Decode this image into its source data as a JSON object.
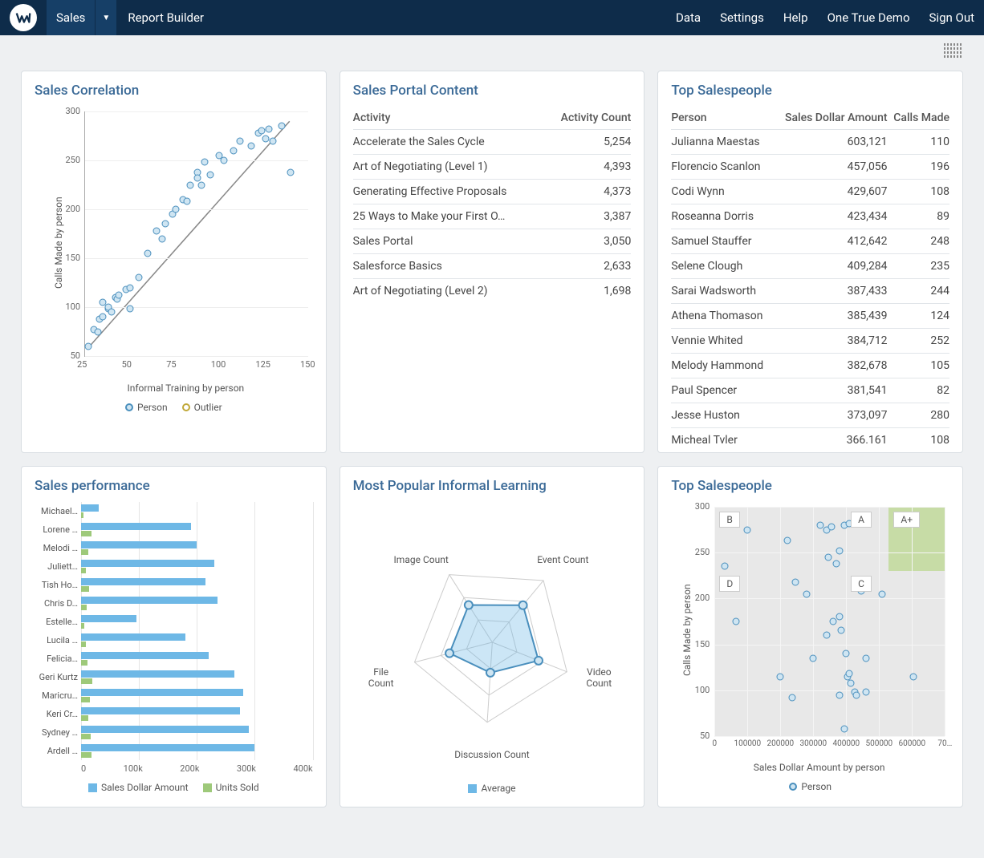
{
  "nav": {
    "sales": "Sales",
    "report_builder": "Report Builder",
    "data": "Data",
    "settings": "Settings",
    "help": "Help",
    "demo": "One True Demo",
    "signout": "Sign Out"
  },
  "cards": {
    "sales_correlation": {
      "title": "Sales Correlation",
      "ylabel": "Calls Made by person",
      "xlabel": "Informal Training by person",
      "legend_person": "Person",
      "legend_outlier": "Outlier"
    },
    "sales_portal": {
      "title": "Sales Portal Content",
      "col_activity": "Activity",
      "col_count": "Activity Count"
    },
    "top_salespeople_tbl": {
      "title": "Top Salespeople",
      "col_person": "Person",
      "col_amount": "Sales Dollar Amount",
      "col_calls": "Calls Made"
    },
    "sales_perf": {
      "title": "Sales performance",
      "legend_sales": "Sales Dollar Amount",
      "legend_units": "Units Sold"
    },
    "informal": {
      "title": "Most Popular Informal Learning",
      "legend_avg": "Average",
      "ax_image": "Image Count",
      "ax_event": "Event Count",
      "ax_video": "Video\nCount",
      "ax_disc": "Discussion Count",
      "ax_file": "File\nCount"
    },
    "top_salespeople_sc": {
      "title": "Top Salespeople",
      "ylabel": "Calls Made by person",
      "xlabel": "Sales Dollar Amount by person",
      "legend_person": "Person",
      "qA": "A",
      "qAplus": "A+",
      "qB": "B",
      "qC": "C",
      "qD": "D"
    }
  },
  "portal_rows": [
    {
      "activity": "Accelerate the Sales Cycle",
      "count": "5,254"
    },
    {
      "activity": "Art of Negotiating (Level 1)",
      "count": "4,393"
    },
    {
      "activity": "Generating Effective Proposals",
      "count": "4,373"
    },
    {
      "activity": "25 Ways to Make your First O…",
      "count": "3,387"
    },
    {
      "activity": "Sales Portal",
      "count": "3,050"
    },
    {
      "activity": "Salesforce Basics",
      "count": "2,633"
    },
    {
      "activity": "Art of Negotiating (Level 2)",
      "count": "1,698"
    }
  ],
  "top_rows": [
    {
      "person": "Julianna Maestas",
      "amount": "603,121",
      "calls": "110"
    },
    {
      "person": "Florencio Scanlon",
      "amount": "457,056",
      "calls": "196"
    },
    {
      "person": "Codi Wynn",
      "amount": "429,607",
      "calls": "108"
    },
    {
      "person": "Roseanna Dorris",
      "amount": "423,434",
      "calls": "89"
    },
    {
      "person": "Samuel Stauffer",
      "amount": "412,642",
      "calls": "248"
    },
    {
      "person": "Selene Clough",
      "amount": "409,284",
      "calls": "235"
    },
    {
      "person": "Sarai Wadsworth",
      "amount": "387,433",
      "calls": "244"
    },
    {
      "person": "Athena Thomason",
      "amount": "385,439",
      "calls": "124"
    },
    {
      "person": "Vennie Whited",
      "amount": "384,712",
      "calls": "252"
    },
    {
      "person": "Melody Hammond",
      "amount": "382,678",
      "calls": "105"
    },
    {
      "person": "Paul Spencer",
      "amount": "381,541",
      "calls": "82"
    },
    {
      "person": "Jesse Huston",
      "amount": "373,097",
      "calls": "280"
    },
    {
      "person": "Micheal Tvler",
      "amount": "366.161",
      "calls": "108"
    }
  ],
  "perf_rows": [
    {
      "name": "Michael…",
      "sales": 30000,
      "units": 4000
    },
    {
      "name": "Lorene …",
      "sales": 190000,
      "units": 18000
    },
    {
      "name": "Melodi …",
      "sales": 200000,
      "units": 12000
    },
    {
      "name": "Juliett…",
      "sales": 230000,
      "units": 8000
    },
    {
      "name": "Tish Ho…",
      "sales": 215000,
      "units": 14000
    },
    {
      "name": "Chris D…",
      "sales": 235000,
      "units": 10000
    },
    {
      "name": "Estelle…",
      "sales": 95000,
      "units": 6000
    },
    {
      "name": "Lucila …",
      "sales": 180000,
      "units": 9000
    },
    {
      "name": "Felicia…",
      "sales": 220000,
      "units": 11000
    },
    {
      "name": "Geri Kurtz",
      "sales": 265000,
      "units": 20000
    },
    {
      "name": "Maricru…",
      "sales": 280000,
      "units": 15000
    },
    {
      "name": "Keri Cr…",
      "sales": 275000,
      "units": 12000
    },
    {
      "name": "Sydney …",
      "sales": 290000,
      "units": 16000
    },
    {
      "name": "Ardell …",
      "sales": 300000,
      "units": 18000
    }
  ],
  "perf_axis": [
    "0",
    "100k",
    "200k",
    "300k",
    "400k"
  ],
  "corr_yticks": [
    "50",
    "100",
    "150",
    "200",
    "250",
    "300"
  ],
  "corr_xticks": [
    "25",
    "50",
    "75",
    "100",
    "125",
    "150"
  ],
  "sc2_yticks": [
    "50",
    "100",
    "150",
    "200",
    "250",
    "300"
  ],
  "sc2_xticks": [
    "0",
    "100000",
    "200000",
    "300000",
    "400000",
    "500000",
    "600000",
    "70…"
  ],
  "chart_data": [
    {
      "id": "sales_correlation",
      "type": "scatter",
      "title": "Sales Correlation",
      "xlabel": "Informal Training by person",
      "ylabel": "Calls Made by person",
      "xlim": [
        25,
        150
      ],
      "ylim": [
        50,
        300
      ],
      "series": [
        {
          "name": "Person",
          "points": [
            [
              27,
              60
            ],
            [
              30,
              77
            ],
            [
              32,
              75
            ],
            [
              33,
              88
            ],
            [
              35,
              90
            ],
            [
              35,
              105
            ],
            [
              38,
              98
            ],
            [
              38,
              100
            ],
            [
              40,
              95
            ],
            [
              42,
              110
            ],
            [
              43,
              108
            ],
            [
              44,
              112
            ],
            [
              48,
              118
            ],
            [
              50,
              120
            ],
            [
              50,
              98
            ],
            [
              55,
              130
            ],
            [
              60,
              155
            ],
            [
              65,
              178
            ],
            [
              68,
              170
            ],
            [
              70,
              185
            ],
            [
              74,
              195
            ],
            [
              76,
              200
            ],
            [
              80,
              210
            ],
            [
              82,
              208
            ],
            [
              84,
              225
            ],
            [
              88,
              238
            ],
            [
              88,
              232
            ],
            [
              90,
              225
            ],
            [
              92,
              248
            ],
            [
              95,
              235
            ],
            [
              100,
              255
            ],
            [
              103,
              250
            ],
            [
              108,
              260
            ],
            [
              112,
              270
            ],
            [
              118,
              265
            ],
            [
              122,
              278
            ],
            [
              124,
              280
            ],
            [
              126,
              272
            ],
            [
              128,
              282
            ],
            [
              130,
              270
            ],
            [
              135,
              285
            ],
            [
              140,
              238
            ]
          ]
        },
        {
          "name": "Outlier",
          "points": []
        }
      ],
      "trendline": {
        "x1": 27,
        "y1": 58,
        "x2": 140,
        "y2": 290
      }
    },
    {
      "id": "sales_portal_content",
      "type": "table",
      "title": "Sales Portal Content",
      "columns": [
        "Activity",
        "Activity Count"
      ],
      "rows": [
        [
          "Accelerate the Sales Cycle",
          5254
        ],
        [
          "Art of Negotiating (Level 1)",
          4393
        ],
        [
          "Generating Effective Proposals",
          4373
        ],
        [
          "25 Ways to Make your First O…",
          3387
        ],
        [
          "Sales Portal",
          3050
        ],
        [
          "Salesforce Basics",
          2633
        ],
        [
          "Art of Negotiating (Level 2)",
          1698
        ]
      ]
    },
    {
      "id": "top_salespeople_table",
      "type": "table",
      "title": "Top Salespeople",
      "columns": [
        "Person",
        "Sales Dollar Amount",
        "Calls Made"
      ],
      "rows": [
        [
          "Julianna Maestas",
          603121,
          110
        ],
        [
          "Florencio Scanlon",
          457056,
          196
        ],
        [
          "Codi Wynn",
          429607,
          108
        ],
        [
          "Roseanna Dorris",
          423434,
          89
        ],
        [
          "Samuel Stauffer",
          412642,
          248
        ],
        [
          "Selene Clough",
          409284,
          235
        ],
        [
          "Sarai Wadsworth",
          387433,
          244
        ],
        [
          "Athena Thomason",
          385439,
          124
        ],
        [
          "Vennie Whited",
          384712,
          252
        ],
        [
          "Melody Hammond",
          382678,
          105
        ],
        [
          "Paul Spencer",
          381541,
          82
        ],
        [
          "Jesse Huston",
          373097,
          280
        ],
        [
          "Micheal Tvler",
          366161,
          108
        ]
      ]
    },
    {
      "id": "sales_performance",
      "type": "bar",
      "orientation": "horizontal",
      "title": "Sales performance",
      "xlabel": "",
      "xlim": [
        0,
        400000
      ],
      "categories": [
        "Michael…",
        "Lorene …",
        "Melodi …",
        "Juliett…",
        "Tish Ho…",
        "Chris D…",
        "Estelle…",
        "Lucila …",
        "Felicia…",
        "Geri Kurtz",
        "Maricru…",
        "Keri Cr…",
        "Sydney …",
        "Ardell …"
      ],
      "series": [
        {
          "name": "Sales Dollar Amount",
          "values": [
            30000,
            190000,
            200000,
            230000,
            215000,
            235000,
            95000,
            180000,
            220000,
            265000,
            280000,
            275000,
            290000,
            300000
          ]
        },
        {
          "name": "Units Sold",
          "values": [
            4000,
            18000,
            12000,
            8000,
            14000,
            10000,
            6000,
            9000,
            11000,
            20000,
            15000,
            12000,
            16000,
            18000
          ]
        }
      ]
    },
    {
      "id": "most_popular_informal",
      "type": "radar",
      "title": "Most Popular Informal Learning",
      "axes": [
        "Image Count",
        "Event Count",
        "Video Count",
        "Discussion Count",
        "File Count"
      ],
      "series": [
        {
          "name": "Average",
          "values": [
            0.55,
            0.6,
            0.62,
            0.38,
            0.55
          ]
        }
      ]
    },
    {
      "id": "top_salespeople_scatter",
      "type": "scatter",
      "title": "Top Salespeople",
      "xlabel": "Sales Dollar Amount by person",
      "ylabel": "Calls Made by person",
      "xlim": [
        0,
        700000
      ],
      "ylim": [
        50,
        300
      ],
      "quadrants": {
        "A": [
          400000,
          700000,
          230,
          300
        ],
        "A+": [
          530000,
          700000,
          230,
          300
        ],
        "B": [
          0,
          400000,
          230,
          300
        ],
        "C": [
          400000,
          700000,
          50,
          230
        ],
        "D": [
          0,
          400000,
          50,
          230
        ]
      },
      "series": [
        {
          "name": "Person",
          "points": [
            [
              30000,
              235
            ],
            [
              100000,
              275
            ],
            [
              220000,
              263
            ],
            [
              320000,
              280
            ],
            [
              340000,
              275
            ],
            [
              355000,
              278
            ],
            [
              345000,
              245
            ],
            [
              380000,
              252
            ],
            [
              395000,
              280
            ],
            [
              370000,
              238
            ],
            [
              410000,
              282
            ],
            [
              245000,
              218
            ],
            [
              280000,
              205
            ],
            [
              300000,
              135
            ],
            [
              340000,
              160
            ],
            [
              65000,
              175
            ],
            [
              200000,
              115
            ],
            [
              235000,
              92
            ],
            [
              360000,
              175
            ],
            [
              380000,
              180
            ],
            [
              385000,
              165
            ],
            [
              400000,
              140
            ],
            [
              405000,
              115
            ],
            [
              410000,
              118
            ],
            [
              415000,
              108
            ],
            [
              425000,
              98
            ],
            [
              430000,
              95
            ],
            [
              380000,
              95
            ],
            [
              395000,
              58
            ],
            [
              445000,
              208
            ],
            [
              510000,
              205
            ],
            [
              460000,
              135
            ],
            [
              605000,
              115
            ],
            [
              460000,
              98
            ]
          ]
        }
      ]
    }
  ]
}
